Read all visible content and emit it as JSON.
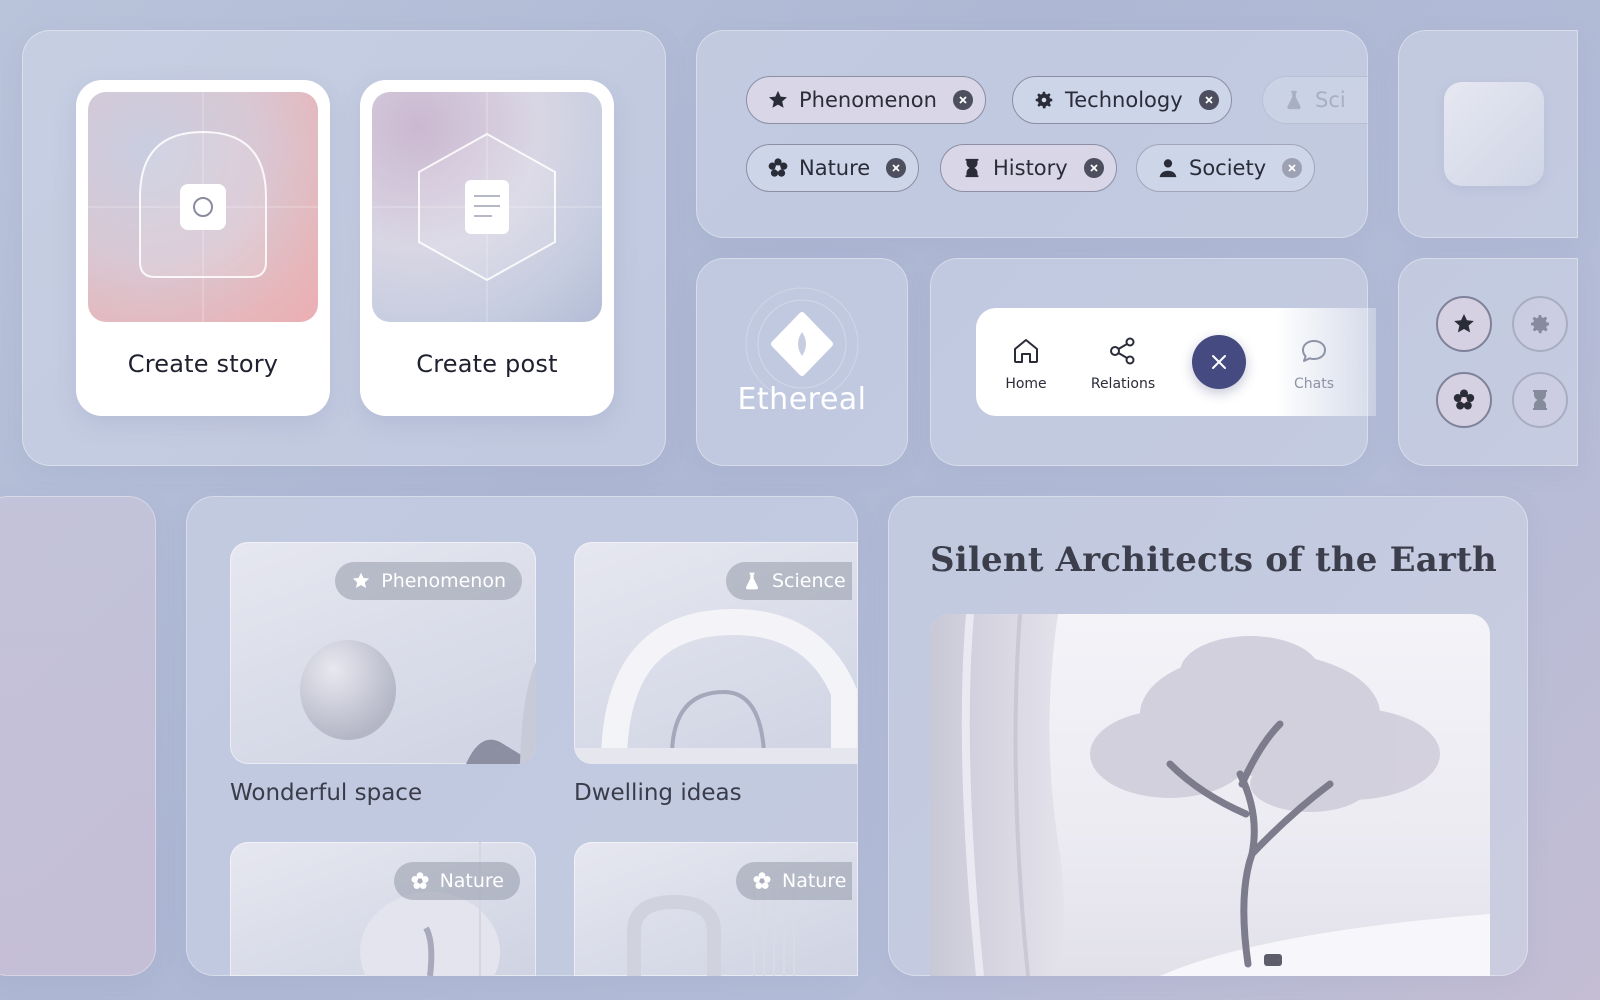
{
  "create_cards": [
    {
      "label": "Create story",
      "icon": "camera-icon"
    },
    {
      "label": "Create post",
      "icon": "document-icon"
    }
  ],
  "chips": [
    {
      "label": "Phenomenon",
      "icon": "star-icon"
    },
    {
      "label": "Technology",
      "icon": "gear-icon"
    },
    {
      "label": "Sci",
      "icon": "flask-icon"
    },
    {
      "label": "Nature",
      "icon": "flower-icon"
    },
    {
      "label": "History",
      "icon": "hourglass-icon"
    },
    {
      "label": "Society",
      "icon": "person-icon"
    }
  ],
  "brand": {
    "name": "Ethereal",
    "icon": "ethereal-logo-icon"
  },
  "navbar": {
    "items": [
      {
        "label": "Home",
        "icon": "home-icon"
      },
      {
        "label": "Relations",
        "icon": "relations-icon"
      },
      {
        "label": "Chats",
        "icon": "chat-icon"
      }
    ],
    "close_icon": "close-icon"
  },
  "category_buttons": [
    "star-icon",
    "gear-icon",
    "flower-icon",
    "hourglass-icon"
  ],
  "content_cards": [
    {
      "title": "Wonderful space",
      "tag": "Phenomenon",
      "tag_icon": "star-icon"
    },
    {
      "title": "Dwelling ideas",
      "tag": "Science",
      "tag_icon": "flask-icon"
    },
    {
      "title": "",
      "tag": "Nature",
      "tag_icon": "flower-icon"
    },
    {
      "title": "",
      "tag": "Nature",
      "tag_icon": "flower-icon"
    }
  ],
  "article": {
    "title": "Silent Architects of the Earth"
  },
  "colors": {
    "accent": "#454b80",
    "background": "#b3bcd7",
    "chip_border": "#8c8ea4"
  }
}
